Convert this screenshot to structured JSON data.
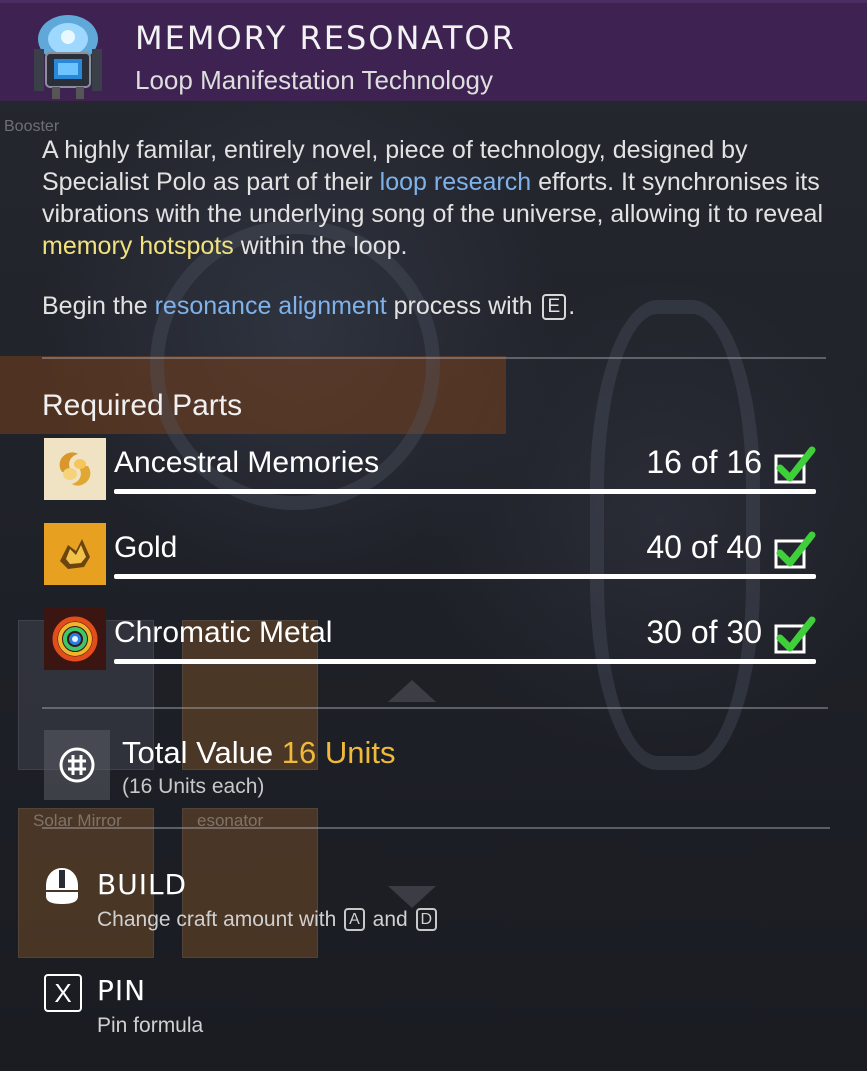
{
  "item": {
    "title": "MEMORY RESONATOR",
    "subtitle": "Loop Manifestation Technology"
  },
  "description": {
    "part1": "A highly familar, entirely novel, piece of technology, designed by Specialist Polo as part of their ",
    "link1": "loop research",
    "part2": " efforts. It synchronises its vibrations with the underlying song of the universe, allowing it to reveal ",
    "link2": "memory hotspots",
    "part3": " within the loop."
  },
  "instruction": {
    "prefix": "Begin the ",
    "link": "resonance alignment",
    "middle": " process with ",
    "key": "E",
    "suffix": "."
  },
  "required_parts": {
    "title": "Required Parts",
    "items": [
      {
        "name": "Ancestral Memories",
        "count": "16 of 16",
        "icon": "ancestral-memories-icon"
      },
      {
        "name": "Gold",
        "count": "40 of 40",
        "icon": "gold-icon"
      },
      {
        "name": "Chromatic Metal",
        "count": "30 of 30",
        "icon": "chromatic-metal-icon"
      }
    ]
  },
  "value": {
    "label": "Total Value",
    "units": "16 Units",
    "each": "(16 Units each)"
  },
  "actions": {
    "build": {
      "label": "BUILD",
      "sub_prefix": "Change craft amount with ",
      "key1": "A",
      "and": " and ",
      "key2": "D"
    },
    "pin": {
      "key": "X",
      "label": "PIN",
      "sub": "Pin formula"
    }
  },
  "background": {
    "booster_label": "Booster",
    "tile1_label": "Solar Mirror",
    "tile2_label": "esonator"
  },
  "colors": {
    "header_bg": "#3d2252",
    "highlight_blue": "#7fb2ea",
    "highlight_yellow": "#f2e27e",
    "units_gold": "#f0b93a",
    "check_green": "#3fcf3a"
  }
}
